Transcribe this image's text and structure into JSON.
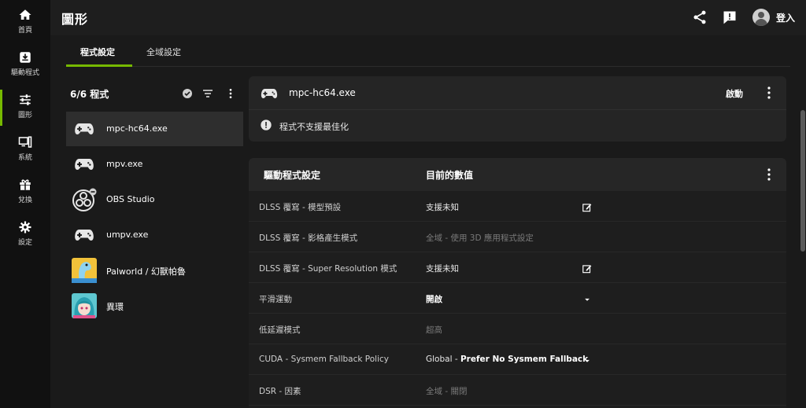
{
  "nav": {
    "items": [
      {
        "label": "首頁",
        "icon": "home-icon"
      },
      {
        "label": "驅動程式",
        "icon": "driver-download-icon"
      },
      {
        "label": "圖形",
        "icon": "graphics-sliders-icon"
      },
      {
        "label": "系統",
        "icon": "system-monitor-icon"
      },
      {
        "label": "兌換",
        "icon": "gift-icon"
      },
      {
        "label": "設定",
        "icon": "gear-icon"
      }
    ],
    "active_index": 2,
    "accent": "#76b900"
  },
  "header": {
    "title": "圖形",
    "login_label": "登入",
    "icons": [
      "share-icon",
      "feedback-icon",
      "avatar-icon"
    ]
  },
  "tabs": [
    {
      "label": "程式設定",
      "active": true
    },
    {
      "label": "全域設定",
      "active": false
    }
  ],
  "program_list": {
    "title": "6/6 程式",
    "items": [
      {
        "name": "mpc-hc64.exe",
        "icon": "gamepad-icon",
        "selected": true
      },
      {
        "name": "mpv.exe",
        "icon": "gamepad-icon",
        "selected": false
      },
      {
        "name": "OBS Studio",
        "icon": "obs-logo-icon",
        "selected": false
      },
      {
        "name": "umpv.exe",
        "icon": "gamepad-icon",
        "selected": false
      },
      {
        "name": "Palworld / 幻獸帕魯",
        "icon": "palworld-app-icon",
        "selected": false
      },
      {
        "name": "異環",
        "icon": "yihuan-app-icon",
        "selected": false
      }
    ]
  },
  "app_card": {
    "name": "mpc-hc64.exe",
    "launch_label": "啟動",
    "warning": "程式不支援最佳化"
  },
  "settings": {
    "col_setting": "驅動程式設定",
    "col_value": "目前的數值",
    "rows": [
      {
        "name": "DLSS 覆寫 - 模型預設",
        "value": "支援未知",
        "style": "normal",
        "control": "edit"
      },
      {
        "name": "DLSS 覆寫 - 影格產生模式",
        "value": "全域 - 使用 3D 應用程式設定",
        "style": "dim",
        "control": "none"
      },
      {
        "name": "DLSS 覆寫 - Super Resolution 模式",
        "value": "支援未知",
        "style": "normal",
        "control": "edit"
      },
      {
        "name": "平滑運動",
        "value": "開啟",
        "style": "bold",
        "control": "dropdown"
      },
      {
        "name": "低延遲模式",
        "value": "超高",
        "style": "dim",
        "control": "none"
      },
      {
        "name": "CUDA - Sysmem Fallback Policy",
        "value_prefix": "Global - ",
        "value": "Prefer No Sysmem Fallback",
        "style": "mixed",
        "control": "dropdown"
      },
      {
        "name": "DSR - 因素",
        "value": "全域 - 關閉",
        "style": "dim",
        "control": "none"
      }
    ]
  }
}
